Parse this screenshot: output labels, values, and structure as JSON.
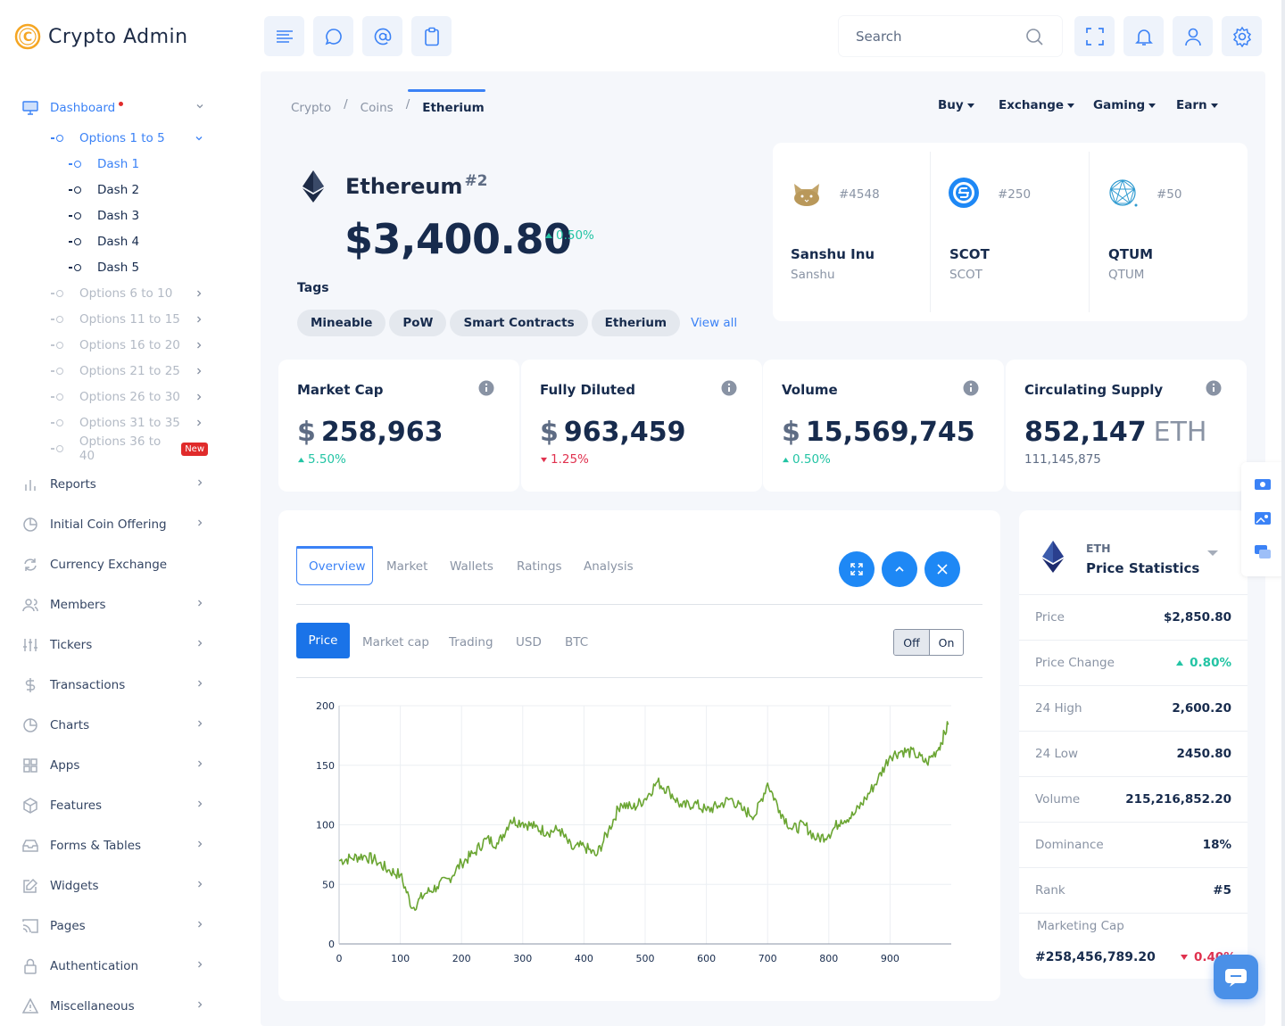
{
  "brand": {
    "name": "Crypto Admin"
  },
  "sidebar": {
    "dashboard": "Dashboard",
    "options_1_5": "Options 1 to 5",
    "dash_items": [
      "Dash 1",
      "Dash 2",
      "Dash 3",
      "Dash 4",
      "Dash 5"
    ],
    "options": [
      "Options 6 to 10",
      "Options 11 to 15",
      "Options 16 to 20",
      "Options 21 to 25",
      "Options 26 to 30",
      "Options 31 to 35",
      "Options 36 to 40"
    ],
    "new_badge": "New",
    "items": [
      "Reports",
      "Initial Coin Offering",
      "Currency Exchange",
      "Members",
      "Tickers",
      "Transactions",
      "Charts",
      "Apps",
      "Features",
      "Forms & Tables",
      "Widgets",
      "Pages",
      "Authentication",
      "Miscellaneous"
    ]
  },
  "topbar": {
    "search_placeholder": "Search"
  },
  "breadcrumb": [
    "Crypto",
    "Coins",
    "Etherium"
  ],
  "top_menu": [
    "Buy",
    "Exchange",
    "Gaming",
    "Earn"
  ],
  "coin": {
    "name": "Ethereum",
    "rank": "#2",
    "price": "$3,400.80",
    "change": "0.50%"
  },
  "tags": {
    "label": "Tags",
    "items": [
      "Mineable",
      "PoW",
      "Smart Contracts",
      "Etherium"
    ],
    "view_all": "View all"
  },
  "trending": [
    {
      "rank": "#4548",
      "name": "Sanshu Inu",
      "symbol": "Sanshu"
    },
    {
      "rank": "#250",
      "name": "SCOT",
      "symbol": "SCOT"
    },
    {
      "rank": "#50",
      "name": "QTUM",
      "symbol": "QTUM"
    }
  ],
  "stats": [
    {
      "title": "Market Cap",
      "prefix": "$",
      "value": "258,963",
      "sub": "5.50%",
      "dir": "up"
    },
    {
      "title": "Fully Diluted",
      "prefix": "$",
      "value": "963,459",
      "sub": "1.25%",
      "dir": "down"
    },
    {
      "title": "Volume",
      "prefix": "$",
      "value": "15,569,745",
      "sub": "0.50%",
      "dir": "up"
    },
    {
      "title": "Circulating Supply",
      "prefix": "",
      "value": "852,147",
      "unit": "ETH",
      "sub": "111,145,875",
      "dir": "none"
    }
  ],
  "chart_tabs": [
    "Overview",
    "Market",
    "Wallets",
    "Ratings",
    "Analysis"
  ],
  "chart_subtabs": [
    "Price",
    "Market cap",
    "Trading",
    "USD",
    "BTC"
  ],
  "toggle": {
    "off": "Off",
    "on": "On"
  },
  "chart_data": {
    "type": "line",
    "xlim": [
      0,
      1000
    ],
    "ylim": [
      0,
      200
    ],
    "xticks": [
      0,
      100,
      200,
      300,
      400,
      500,
      600,
      700,
      800,
      900
    ],
    "yticks": [
      0,
      50,
      100,
      150,
      200
    ],
    "color": "#6aa532",
    "grid": true,
    "x": [
      0,
      20,
      40,
      60,
      80,
      100,
      120,
      140,
      160,
      180,
      200,
      220,
      240,
      260,
      280,
      300,
      320,
      340,
      360,
      380,
      400,
      420,
      440,
      460,
      480,
      500,
      520,
      540,
      560,
      580,
      600,
      620,
      640,
      660,
      680,
      700,
      720,
      740,
      760,
      780,
      800,
      820,
      840,
      860,
      880,
      900,
      920,
      940,
      960,
      980,
      995
    ],
    "values": [
      70,
      72,
      74,
      70,
      62,
      58,
      30,
      42,
      48,
      55,
      68,
      76,
      88,
      84,
      104,
      102,
      98,
      94,
      96,
      80,
      82,
      74,
      95,
      118,
      114,
      122,
      136,
      128,
      115,
      118,
      112,
      116,
      122,
      112,
      108,
      135,
      112,
      96,
      100,
      88,
      92,
      104,
      108,
      122,
      138,
      158,
      162,
      160,
      152,
      165,
      184
    ]
  },
  "price_stats": {
    "coin": "ETH",
    "title": "Price Statistics",
    "rows": [
      {
        "k": "Price",
        "v": "$2,850.80"
      },
      {
        "k": "Price Change",
        "v": "0.80%"
      },
      {
        "k": "24 High",
        "v": "2,600.20"
      },
      {
        "k": "24 Low",
        "v": "2450.80"
      },
      {
        "k": "Volume",
        "v": "215,216,852.20"
      },
      {
        "k": "Dominance",
        "v": "18%"
      },
      {
        "k": "Rank",
        "v": "#5"
      }
    ],
    "marketing_cap_label": "Marketing Cap",
    "marketing_cap_value": "#258,456,789.20",
    "marketing_cap_change": "0.40%"
  },
  "colors": {
    "accent": "#3b82f6",
    "button_blue": "#1e88f5",
    "up": "#23c4a4",
    "down": "#e0314e",
    "line": "#6aa532"
  }
}
